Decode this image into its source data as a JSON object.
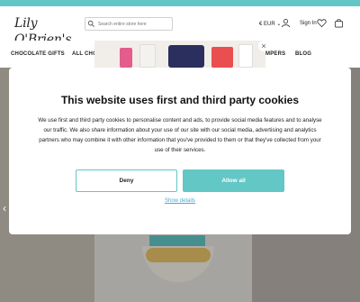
{
  "brand": {
    "logo_text": "Lily O'Brien's"
  },
  "header": {
    "search_placeholder": "Search entire store here",
    "currency": "€ EUR",
    "currency_chevron": "⌄",
    "signin": "Sign In",
    "icons": [
      "search-icon",
      "user-icon",
      "heart-icon",
      "bag-icon"
    ]
  },
  "nav": {
    "items": [
      "CHOCOLATE GIFTS",
      "ALL CHO",
      "MPERS",
      "BLOG"
    ]
  },
  "cookie_modal": {
    "title": "This website uses first and third party cookies",
    "body": "We use first and third party cookies to personalise content and ads, to provide social media features and to analyse our traffic. We also share information about your use of our site with our social media, advertising and analytics partners who may combine it with other information that you've provided to them or that they've collected from your use of their services.",
    "deny_label": "Deny",
    "allow_label": "Allow all",
    "details_label": "Show details",
    "close_glyph": "×"
  },
  "hero": {
    "prev_glyph": "‹",
    "next_glyph": "›"
  },
  "colors": {
    "accent": "#63c7c5",
    "link": "#4aa9d8"
  }
}
